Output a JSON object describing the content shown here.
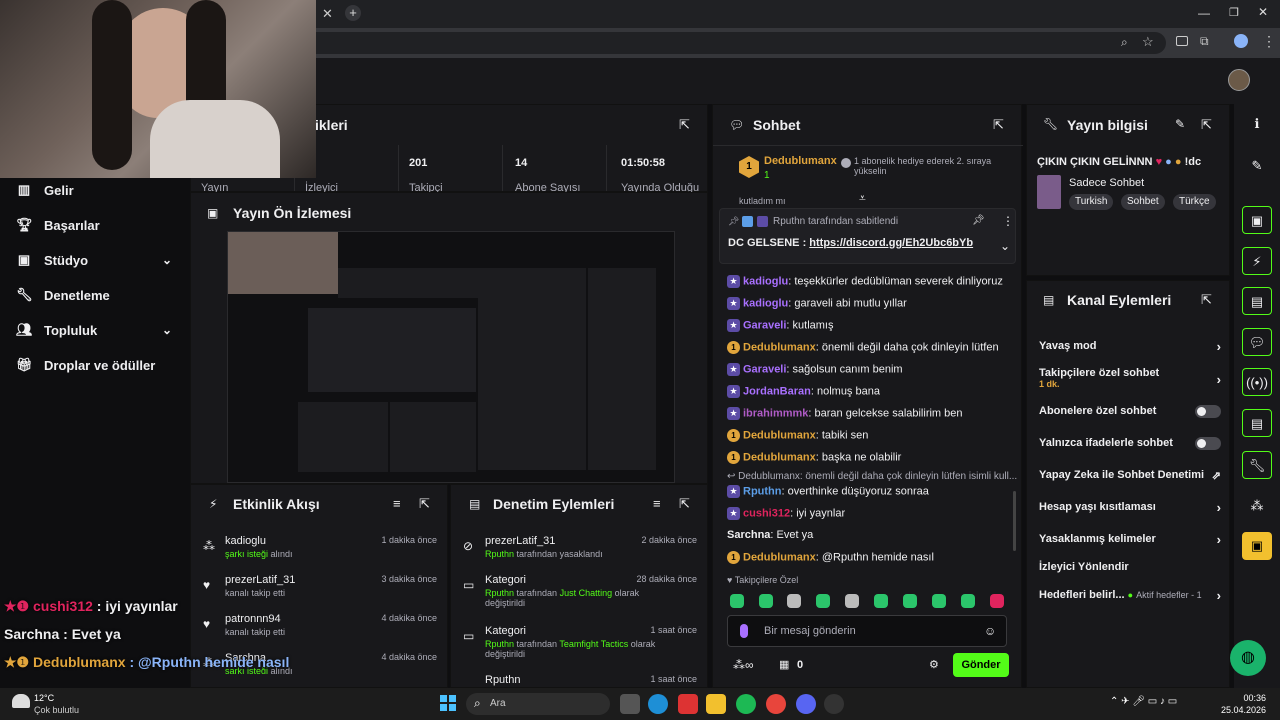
{
  "browser": {
    "new_tab": "+"
  },
  "stats": {
    "title": "ikleri",
    "cells": [
      {
        "value": "",
        "label": "Yayın"
      },
      {
        "value": "",
        "label": "İzleyici"
      },
      {
        "value": "201",
        "label": "Takipçi"
      },
      {
        "value": "14",
        "label": "Abone Sayısı"
      },
      {
        "value": "01:50:58",
        "label": "Yayında Olduğu"
      }
    ]
  },
  "nav": {
    "items": [
      {
        "label": "Gelir"
      },
      {
        "label": "Başarılar"
      },
      {
        "label": "Stüdyo"
      },
      {
        "label": "Denetleme"
      },
      {
        "label": "Topluluk"
      },
      {
        "label": "Droplar ve ödüller"
      }
    ]
  },
  "preview": {
    "title": "Yayın Ön İzlemesi"
  },
  "chat": {
    "title": "Sohbet",
    "hype": {
      "user": "Dedublumanx",
      "count": "1",
      "text": "1 abonelik hediye ederek 2. sıraya yükselin",
      "rank": "1"
    },
    "cut_text": "kutladım mı",
    "pinned": {
      "by": "Rputhn tarafından sabitlendi",
      "text_prefix": "DC GELSENE : ",
      "link": "https://discord.gg/Eh2Ubc6bYb"
    },
    "messages": [
      {
        "user": "kadioglu",
        "text": "teşekkürler dedüblüman severek dinliyoruz",
        "color": "#a970ff"
      },
      {
        "user": "kadioglu",
        "text": "garaveli abi mutlu yıllar",
        "color": "#a970ff"
      },
      {
        "user": "Garaveli",
        "text": "kutlamış",
        "color": "#a970ff"
      },
      {
        "user": "Dedublumanx",
        "text": "önemli değil daha çok dinleyin lütfen",
        "color": "#e1a53c"
      },
      {
        "user": "Garaveli",
        "text": "sağolsun canım benim",
        "color": "#a970ff"
      },
      {
        "user": "JordanBaran",
        "text": "nolmuş bana",
        "color": "#a970ff"
      },
      {
        "user": "ibrahimmmk",
        "text": "baran gelcekse salabilirim ben",
        "color": "#b05cc7"
      },
      {
        "user": "Dedublumanx",
        "text": "tabiki sen",
        "color": "#e1a53c"
      },
      {
        "user": "Dedublumanx",
        "text": "başka ne olabilir",
        "color": "#e1a53c"
      }
    ],
    "reply_context": "Dedublumanx: önemli değil daha çok dinleyin lütfen isimli kull...",
    "messages2": [
      {
        "user": "Rputhn",
        "text": "overthinke düşüyoruz sonraa",
        "color": "#5c9ee8"
      },
      {
        "user": "cushi312",
        "text": "iyi yaynlar",
        "color": "#e0245e"
      },
      {
        "user": "Sarchna",
        "text": "Evet ya",
        "color": "#efeff1"
      },
      {
        "user": "Dedublumanx",
        "text": "@Rputhn hemide nasıl",
        "color": "#e1a53c"
      }
    ],
    "followers_only": "Takipçilere Özel",
    "input_placeholder": "Bir mesaj gönderin",
    "points": "0",
    "send": "Gönder"
  },
  "stream_info": {
    "title": "Yayın bilgisi",
    "stream_title": "ÇIKIN ÇIKIN GELİNNN",
    "command": "!dc",
    "category": "Sadece Sohbet",
    "tags": [
      "Turkish",
      "Sohbet",
      "Türkçe"
    ]
  },
  "channel_actions": {
    "title": "Kanal Eylemleri",
    "items": [
      {
        "label": "Yavaş mod"
      },
      {
        "label": "Takipçilere özel sohbet",
        "sub": "1 dk."
      },
      {
        "label": "Abonelere özel sohbet"
      },
      {
        "label": "Yalnızca ifadelerle sohbet"
      },
      {
        "label": "Yapay Zeka ile Sohbet Denetimi"
      },
      {
        "label": "Hesap yaşı kısıtlaması"
      },
      {
        "label": "Yasaklanmış kelimeler"
      },
      {
        "label": "İzleyici Yönlendir"
      },
      {
        "label": "Hedefleri belirl...",
        "sub": "Aktif hedefler - 1"
      }
    ]
  },
  "activity": {
    "title": "Etkinlik Akışı",
    "items": [
      {
        "name": "kadioglu",
        "sub_hl": "şarkı isteği",
        "sub": " alındı",
        "time": "1 dakika önce"
      },
      {
        "name": "prezerLatif_31",
        "sub_hl": "",
        "sub": "kanalı takip etti",
        "time": "3 dakika önce"
      },
      {
        "name": "patronnn94",
        "sub_hl": "",
        "sub": "kanalı takip etti",
        "time": "4 dakika önce"
      },
      {
        "name": "Sarchna",
        "sub_hl": "şarkı isteği",
        "sub": " alındı",
        "time": "4 dakika önce"
      }
    ]
  },
  "mod_actions": {
    "title": "Denetim Eylemleri",
    "items": [
      {
        "name": "prezerLatif_31",
        "by": "Rputhn",
        "rest": " tarafından yasaklandı",
        "extra": "",
        "extra2": "",
        "time": "2 dakika önce"
      },
      {
        "name": "Kategori",
        "by": "Rputhn",
        "rest": " tarafından ",
        "extra": "Just Chatting",
        "extra2": " olarak değiştirildi",
        "time": "28 dakika önce"
      },
      {
        "name": "Kategori",
        "by": "Rputhn",
        "rest": " tarafından ",
        "extra": "Teamfight Tactics",
        "extra2": " olarak değiştirildi",
        "time": "1 saat önce"
      },
      {
        "name": "Rputhn",
        "by": "",
        "rest": "",
        "extra": "",
        "extra2": "",
        "time": "1 saat önce"
      }
    ]
  },
  "overlay_chat": [
    {
      "user": "cushi312",
      "text": "iyi yayınlar",
      "color": "#e0245e"
    },
    {
      "user": "Sarchna",
      "text": "Evet ya",
      "color": "#efeff1"
    },
    {
      "user": "Dedublumanx",
      "text": "@Rputhn hemide nasıl",
      "color": "#e1a53c"
    }
  ],
  "taskbar": {
    "weather_temp": "12°C",
    "weather_desc": "Çok bulutlu",
    "search": "Ara",
    "time": "00:36",
    "date": "25.04.2026"
  },
  "colors": {
    "accent": "#53fc18",
    "purple": "#a970ff",
    "panel": "#18181b"
  }
}
